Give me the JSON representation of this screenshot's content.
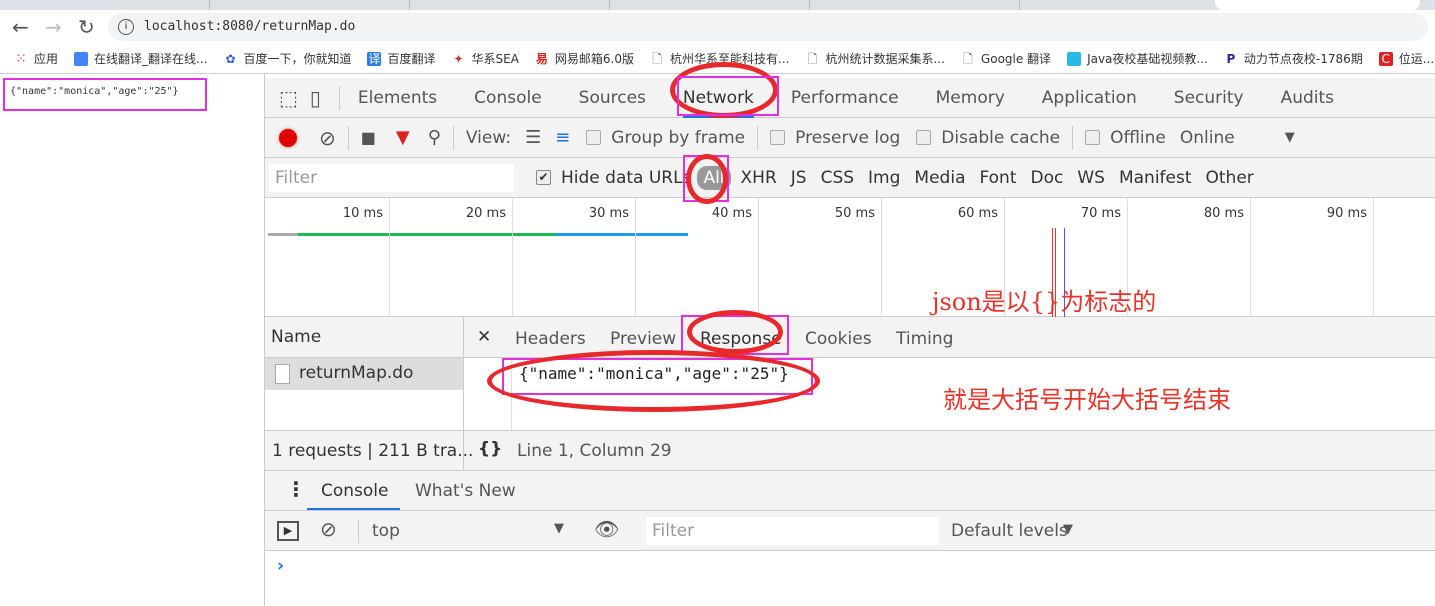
{
  "browser": {
    "url": "localhost:8080/returnMap.do",
    "bookmarks": [
      "应用",
      "在线翻译_翻译在线...",
      "百度一下，你就知道",
      "百度翻译",
      "华系SEA",
      "网易邮箱6.0版",
      "杭州华系至能科技有...",
      "杭州统计数据采集系...",
      "Google 翻译",
      "Java夜校基础视频教...",
      "动力节点夜校-1786期",
      "位运..."
    ]
  },
  "page": {
    "body_text": "{\"name\":\"monica\",\"age\":\"25\"}"
  },
  "devtools": {
    "tabs": [
      "Elements",
      "Console",
      "Sources",
      "Network",
      "Performance",
      "Memory",
      "Application",
      "Security",
      "Audits"
    ],
    "active_tab": "Network",
    "toolbar": {
      "view_label": "View:",
      "group_by_frame": "Group by frame",
      "preserve_log": "Preserve log",
      "disable_cache": "Disable cache",
      "offline": "Offline",
      "throttle": "Online"
    },
    "filter": {
      "placeholder": "Filter",
      "hide_data_urls": "Hide data URLs",
      "hide_data_urls_checked": true,
      "types": [
        "All",
        "XHR",
        "JS",
        "CSS",
        "Img",
        "Media",
        "Font",
        "Doc",
        "WS",
        "Manifest",
        "Other"
      ],
      "active_type": "All"
    },
    "timeline": {
      "ticks": [
        "10 ms",
        "20 ms",
        "30 ms",
        "40 ms",
        "50 ms",
        "60 ms",
        "70 ms",
        "80 ms",
        "90 ms"
      ]
    },
    "name_header": "Name",
    "detail_tabs": [
      "Headers",
      "Preview",
      "Response",
      "Cookies",
      "Timing"
    ],
    "active_detail_tab": "Response",
    "requests": [
      {
        "name": "returnMap.do"
      }
    ],
    "response_body": "{\"name\":\"monica\",\"age\":\"25\"}",
    "status": {
      "summary": "1 requests | 211 B tra...",
      "cursor": "Line 1, Column 29",
      "pretty_print": "{}"
    },
    "drawer": {
      "tabs": [
        "Console",
        "What's New"
      ],
      "context": "top",
      "filter_placeholder": "Filter",
      "levels": "Default levels",
      "prompt": "›"
    }
  },
  "annotations": {
    "note1": "json是以{}为标志的",
    "note2": "就是大括号开始大括号结束"
  },
  "colors": {
    "annotation_red": "#e8322a",
    "highlight_magenta": "#e030e0",
    "accent_blue": "#1a73e8"
  }
}
